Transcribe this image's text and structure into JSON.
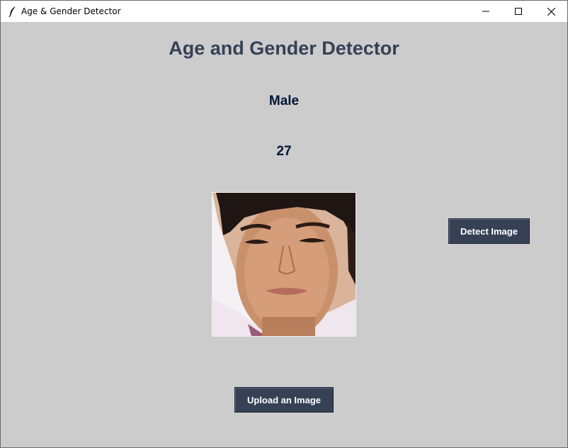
{
  "window": {
    "title": "Age & Gender Detector",
    "controls": {
      "minimize_icon": "minimize-icon",
      "maximize_icon": "maximize-icon",
      "close_icon": "close-icon"
    }
  },
  "main": {
    "heading": "Age and Gender Detector",
    "gender_result": "Male",
    "age_result": "27",
    "detect_button_label": "Detect Image",
    "upload_button_label": "Upload an Image"
  },
  "colors": {
    "background": "#cccccc",
    "heading_text": "#364156",
    "result_text": "#011638",
    "button_bg": "#364156",
    "button_text": "#ffffff"
  }
}
